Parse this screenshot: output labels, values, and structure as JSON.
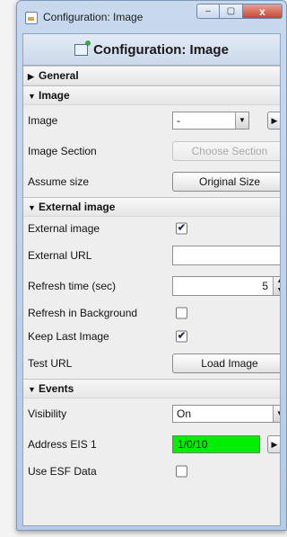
{
  "window": {
    "title": "Configuration: Image",
    "controls": {
      "minimize": "–",
      "maximize": "▢",
      "close": "x"
    }
  },
  "header": {
    "title": "Configuration: Image",
    "icon": "config-icon"
  },
  "sections": {
    "general": {
      "label": "General",
      "expanded": false
    },
    "image": {
      "label": "Image",
      "image_label": "Image",
      "image_value": "-",
      "image_section_label": "Image Section",
      "choose_section_button": "Choose Section",
      "assume_size_label": "Assume size",
      "original_size_button": "Original Size"
    },
    "external": {
      "label": "External image",
      "external_image_label": "External image",
      "external_image_checked": true,
      "external_url_label": "External URL",
      "external_url_value": "",
      "refresh_time_label": "Refresh time (sec)",
      "refresh_time_value": "5",
      "refresh_bg_label": "Refresh in Background",
      "refresh_bg_checked": false,
      "keep_last_label": "Keep Last Image",
      "keep_last_checked": true,
      "test_url_label": "Test URL",
      "load_image_button": "Load Image"
    },
    "events": {
      "label": "Events",
      "visibility_label": "Visibility",
      "visibility_value": "On",
      "address_label": "Address EIS 1",
      "address_value": "1/0/10",
      "address_color": "#00ee00",
      "use_esf_label": "Use ESF Data",
      "use_esf_checked": false
    }
  },
  "glyphs": {
    "expanded": "▼",
    "collapsed": "▶",
    "dropdown": "▼",
    "nav": "▶",
    "check": "✔",
    "spin_up": "▲",
    "spin_down": "▼"
  }
}
